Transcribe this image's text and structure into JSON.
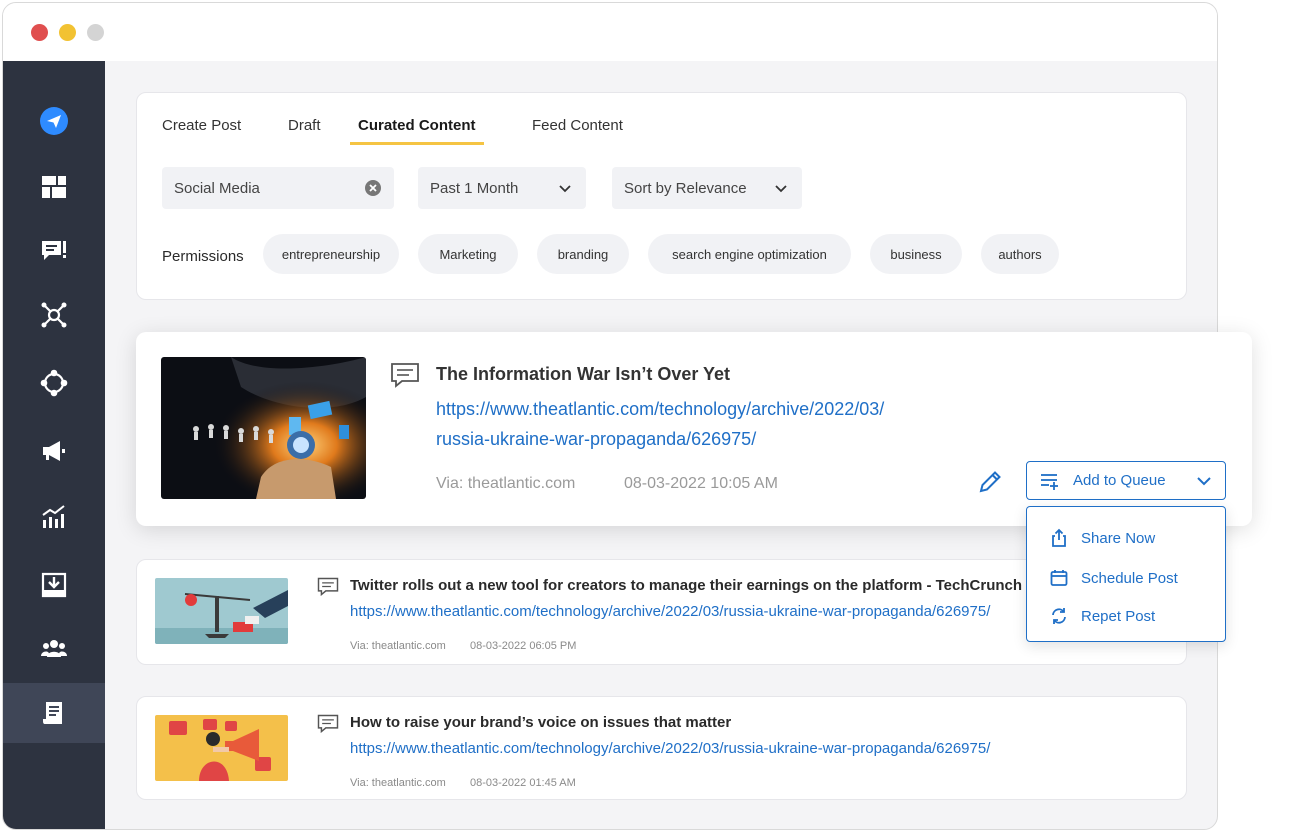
{
  "window": {
    "controls": [
      "close",
      "minimize",
      "maximize"
    ]
  },
  "sidebar": {
    "items": [
      {
        "icon": "send-icon"
      },
      {
        "icon": "dashboard-icon"
      },
      {
        "icon": "comment-icon"
      },
      {
        "icon": "network-icon"
      },
      {
        "icon": "share-icon"
      },
      {
        "icon": "megaphone-icon"
      },
      {
        "icon": "analytics-icon"
      },
      {
        "icon": "download-icon"
      },
      {
        "icon": "team-icon"
      },
      {
        "icon": "document-icon",
        "active": true
      }
    ]
  },
  "tabs": [
    "Create Post",
    "Draft",
    "Curated Content",
    "Feed Content"
  ],
  "active_tab": "Curated Content",
  "filters": {
    "search_value": "Social Media",
    "time_range": "Past 1 Month",
    "sort": "Sort by Relevance"
  },
  "permissions": {
    "label": "Permissions",
    "chips": [
      "entrepreneurship",
      "Marketing",
      "branding",
      "search engine optimization",
      "business",
      "authors"
    ]
  },
  "featured_post": {
    "title": "The Information War Isn’t Over Yet",
    "link_line1": "https://www.theatlantic.com/technology/archive/2022/03/",
    "link_line2": "russia-ukraine-war-propaganda/626975/",
    "via": "Via: theatlantic.com",
    "date": "08-03-2022 10:05 AM"
  },
  "queue_button": {
    "label": "Add to Queue"
  },
  "queue_menu": {
    "items": [
      {
        "label": "Share Now",
        "icon": "share-upload-icon"
      },
      {
        "label": "Schedule Post",
        "icon": "calendar-icon"
      },
      {
        "label": "Repet Post",
        "icon": "repeat-icon"
      }
    ]
  },
  "posts": [
    {
      "title": "Twitter rolls out a new tool for creators to manage their earnings on the platform - TechCrunch",
      "link": "https://www.theatlantic.com/technology/archive/2022/03/russia-ukraine-war-propaganda/626975/",
      "via": "Via: theatlantic.com",
      "date": "08-03-2022 06:05 PM"
    },
    {
      "title": "How to raise your brand’s voice on issues that matter",
      "link": "https://www.theatlantic.com/technology/archive/2022/03/russia-ukraine-war-propaganda/626975/",
      "via": "Via: theatlantic.com",
      "date": "08-03-2022 01:45 AM"
    }
  ],
  "colors": {
    "accent_blue": "#1f6fc7",
    "tab_underline": "#f5c443",
    "sidebar_bg": "#2d3340"
  }
}
